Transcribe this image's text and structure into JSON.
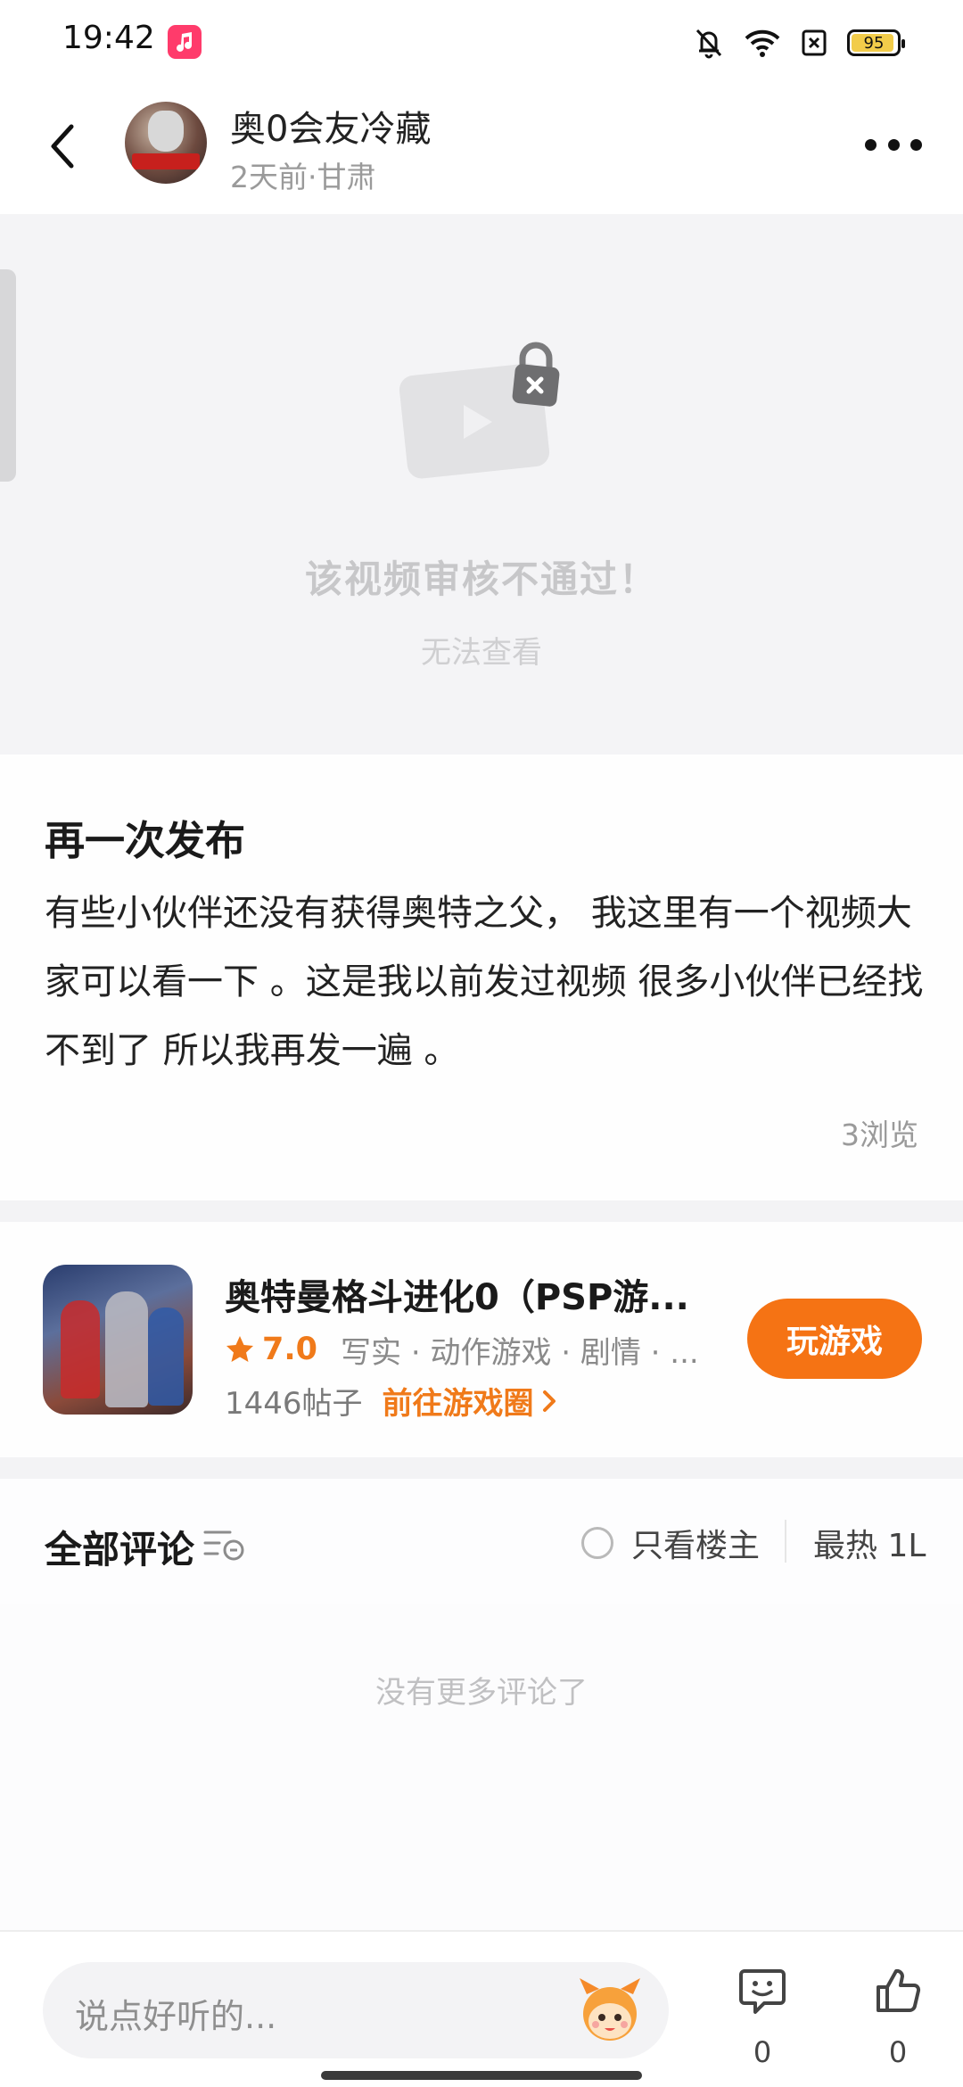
{
  "status_bar": {
    "time": "19:42",
    "battery": "95",
    "battery_level_percent": 95,
    "icons": [
      "music-app-icon",
      "mute-bell-icon",
      "wifi-icon",
      "sim-off-icon",
      "battery-icon"
    ]
  },
  "header": {
    "author_name": "奥0会友冷藏",
    "meta": "2天前·甘肃",
    "back_icon": "chevron-left-icon",
    "more_icon": "more-dots-icon"
  },
  "video": {
    "blocked_title": "该视频审核不通过！",
    "blocked_subtitle": "无法查看",
    "icon": "locked-video-icon"
  },
  "post": {
    "title": "再一次发布",
    "body": "有些小伙伴还没有获得奥特之父， 我这里有一个视频大家可以看一下 。这是我以前发过视频 很多小伙伴已经找不到了 所以我再发一遍 。",
    "views": "3浏览"
  },
  "game": {
    "title": "奥特曼格斗进化0（PSP游...",
    "rating": "7.0",
    "tags": "写实 · 动作游戏 · 剧情 · ...",
    "post_count": "1446帖子",
    "go_circle": "前往游戏圈",
    "play_button": "玩游戏",
    "accent_color": "#f57314"
  },
  "comments": {
    "title": "全部评论",
    "only_host": "只看楼主",
    "sort": "最热 1L",
    "no_more": "没有更多评论了"
  },
  "bottom_bar": {
    "input_placeholder": "说点好听的...",
    "comment_count": "0",
    "like_count": "0"
  }
}
